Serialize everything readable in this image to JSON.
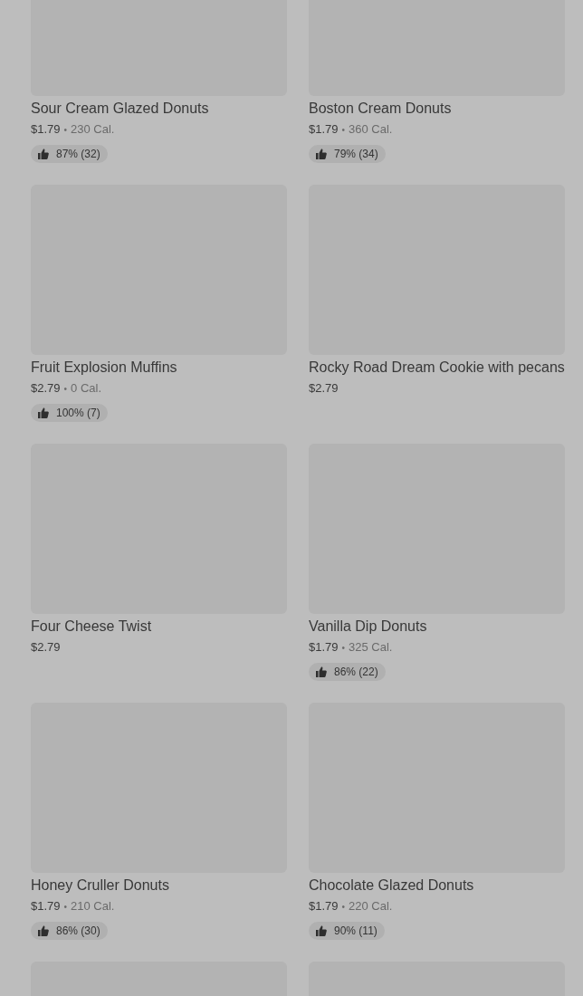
{
  "items": [
    {
      "kind": "item",
      "name": "Sour Cream Glazed Donuts",
      "price": "$1.79",
      "separator": "•",
      "calories": "230 Cal.",
      "rating": "87% (32)"
    },
    {
      "kind": "item",
      "name": "Boston Cream Donuts",
      "price": "$1.79",
      "separator": "•",
      "calories": "360 Cal.",
      "rating": "79% (34)"
    },
    {
      "kind": "item",
      "name": "Fruit Explosion Muffins",
      "price": "$2.79",
      "separator": "•",
      "calories": "0 Cal.",
      "rating": "100% (7)"
    },
    {
      "kind": "item",
      "name": "Rocky Road Dream Cookie with pecans",
      "price": "$2.79"
    },
    {
      "kind": "item",
      "name": "Four Cheese Twist",
      "price": "$2.79"
    },
    {
      "kind": "item",
      "name": "Vanilla Dip Donuts",
      "price": "$1.79",
      "separator": "•",
      "calories": "325 Cal.",
      "rating": "86% (22)"
    },
    {
      "kind": "item",
      "name": "Honey Cruller Donuts",
      "price": "$1.79",
      "separator": "•",
      "calories": "210 Cal.",
      "rating": "86% (30)"
    },
    {
      "kind": "item",
      "name": "Chocolate Glazed Donuts",
      "price": "$1.79",
      "separator": "•",
      "calories": "220 Cal.",
      "rating": "90% (11)"
    },
    {
      "kind": "image-only"
    },
    {
      "kind": "image-only"
    }
  ]
}
